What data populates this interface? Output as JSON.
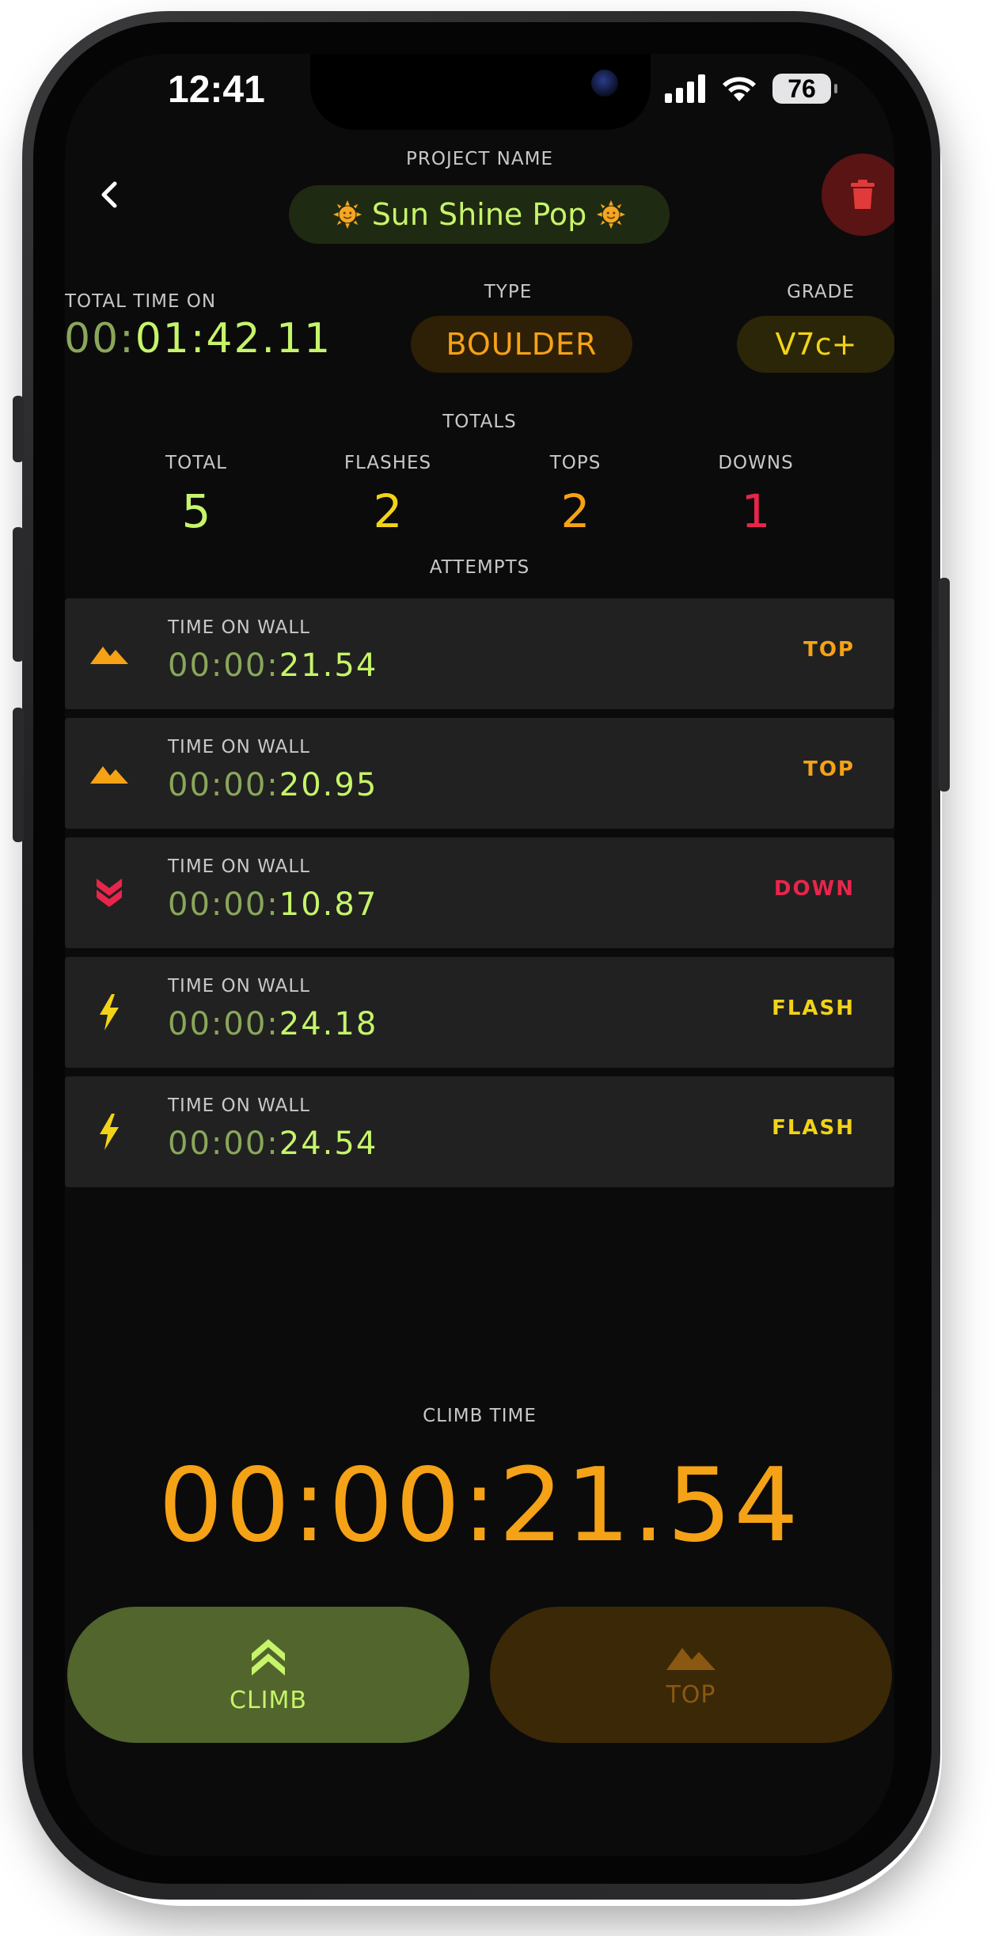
{
  "status_bar": {
    "time": "12:41",
    "battery": "76"
  },
  "header": {
    "project_label": "PROJECT NAME",
    "project_name": "Sun Shine Pop"
  },
  "info": {
    "total_time_label": "TOTAL TIME ON",
    "total_time_dim": "00:",
    "total_time_main": "01:42.11",
    "type_label": "TYPE",
    "type_value": "BOULDER",
    "grade_label": "GRADE",
    "grade_value": "V7c+"
  },
  "totals": {
    "label": "TOTALS",
    "items": [
      {
        "label": "TOTAL",
        "value": "5",
        "color": "#c6f46a"
      },
      {
        "label": "FLASHES",
        "value": "2",
        "color": "#f2d318"
      },
      {
        "label": "TOPS",
        "value": "2",
        "color": "#f5a216"
      },
      {
        "label": "DOWNS",
        "value": "1",
        "color": "#e8254b"
      }
    ]
  },
  "attempts": {
    "label": "ATTEMPTS",
    "items": [
      {
        "icon": "mountain-icon",
        "label": "TIME ON WALL",
        "time_dim": "00:00:",
        "time_main": "21.54",
        "result": "TOP",
        "color": "#f5a216"
      },
      {
        "icon": "mountain-icon",
        "label": "TIME ON WALL",
        "time_dim": "00:00:",
        "time_main": "20.95",
        "result": "TOP",
        "color": "#f5a216"
      },
      {
        "icon": "double-chevron-down-icon",
        "label": "TIME ON WALL",
        "time_dim": "00:00:",
        "time_main": "10.87",
        "result": "DOWN",
        "color": "#e8254b"
      },
      {
        "icon": "lightning-icon",
        "label": "TIME ON WALL",
        "time_dim": "00:00:",
        "time_main": "24.18",
        "result": "FLASH",
        "color": "#f2d318"
      },
      {
        "icon": "lightning-icon",
        "label": "TIME ON WALL",
        "time_dim": "00:00:",
        "time_main": "24.54",
        "result": "FLASH",
        "color": "#f2d318"
      }
    ]
  },
  "climb": {
    "label": "CLIMB TIME",
    "time": "00:00:21.54"
  },
  "actions": {
    "climb_label": "CLIMB",
    "top_label": "TOP"
  },
  "colors": {
    "accent_green": "#c6f46a",
    "accent_orange": "#f5a216",
    "accent_yellow": "#f2d318",
    "accent_red": "#e8254b",
    "delete_red": "#e03a3a"
  }
}
